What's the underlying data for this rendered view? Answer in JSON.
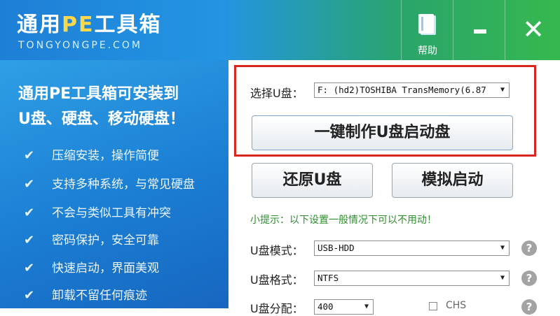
{
  "header": {
    "title_prefix": "通用",
    "title_pe": "PE",
    "title_suffix": "工具箱",
    "subtitle": "TONGYONGPE.COM",
    "help_label": "帮助"
  },
  "left_panel": {
    "headline_1": "通用PE工具箱可安装到",
    "headline_2": "U盘、硬盘、移动硬盘！",
    "features": [
      "压缩安装，操作简便",
      "支持多种系统，与常见硬盘",
      "不会与类似工具有冲突",
      "密码保护，安全可靠",
      "快速启动，界面美观",
      "卸载不留任何痕迹"
    ]
  },
  "right_panel": {
    "select_disk_label": "选择U盘：",
    "select_disk_value": "F: (hd2)TOSHIBA TransMemory(6.87",
    "make_button": "一键制作U盘启动盘",
    "restore_button": "还原U盘",
    "simulate_button": "模拟启动",
    "tip": "小提示：以下设置一般情况下可以不用动！",
    "mode_label": "U盘模式：",
    "mode_value": "USB-HDD",
    "format_label": "U盘格式：",
    "format_value": "NTFS",
    "partition_label": "U盘分配：",
    "partition_value": "400",
    "chs_label": "CHS",
    "help_glyph": "?"
  },
  "colors": {
    "highlight_border": "#d8261f",
    "header_blue": "#1e7fd6",
    "header_green": "#36b84e",
    "tip_green": "#2e8f2e"
  },
  "icons": {
    "help": "book-icon",
    "minimize": "minimize-icon",
    "close": "close-icon",
    "check": "check-icon",
    "question": "question-icon",
    "dropdown": "chevron-down-icon"
  }
}
